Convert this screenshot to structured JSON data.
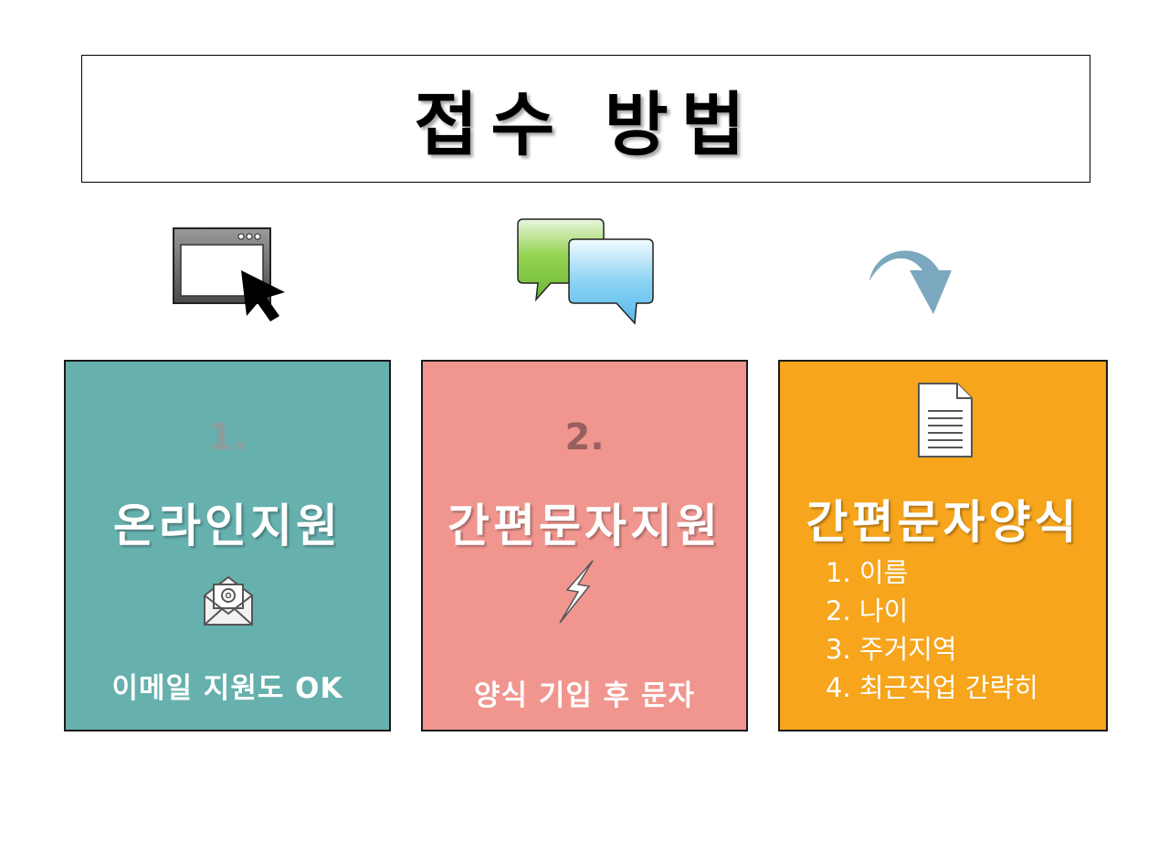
{
  "title": "접수 방법",
  "icons": {
    "browser": "browser-window-click-icon",
    "chat": "chat-bubbles-icon",
    "arrow": "curved-arrow-down-icon"
  },
  "cards": [
    {
      "number": "1.",
      "title": "온라인지원",
      "icon": "email-icon",
      "subtitle": "이메일 지원도 OK",
      "color": "#66b0ae"
    },
    {
      "number": "2.",
      "title": "간편문자지원",
      "icon": "lightning-icon",
      "subtitle": "양식 기입 후 문자",
      "color": "#f0968f"
    },
    {
      "title": "간편문자양식",
      "icon": "document-icon",
      "items": [
        "1. 이름",
        "2. 나이",
        "3. 주거지역",
        "4. 최근직업 간략히"
      ],
      "color": "#f6a51c"
    }
  ]
}
